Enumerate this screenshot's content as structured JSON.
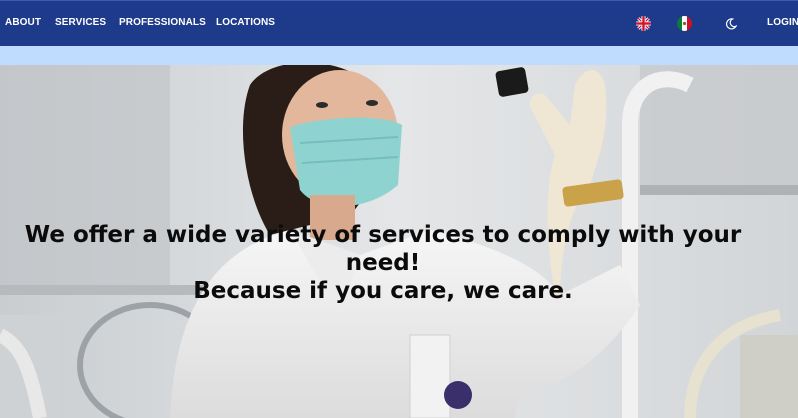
{
  "nav": {
    "links": [
      "ABOUT",
      "SERVICES",
      "PROFESSIONALS",
      "LOCATIONS"
    ],
    "login_label": "LOGIN",
    "language_icons": [
      "uk-flag-icon",
      "mexico-flag-icon"
    ],
    "theme_icon": "moon-icon"
  },
  "hero": {
    "line1": "We offer a wide variety of services to comply with your need!",
    "line2": "Because if you care, we care."
  },
  "colors": {
    "nav_bg": "#1e3a8a",
    "subbar_bg": "#bfdbfe",
    "nav_text": "#ffffff",
    "headline_text": "#0b0b0b"
  }
}
